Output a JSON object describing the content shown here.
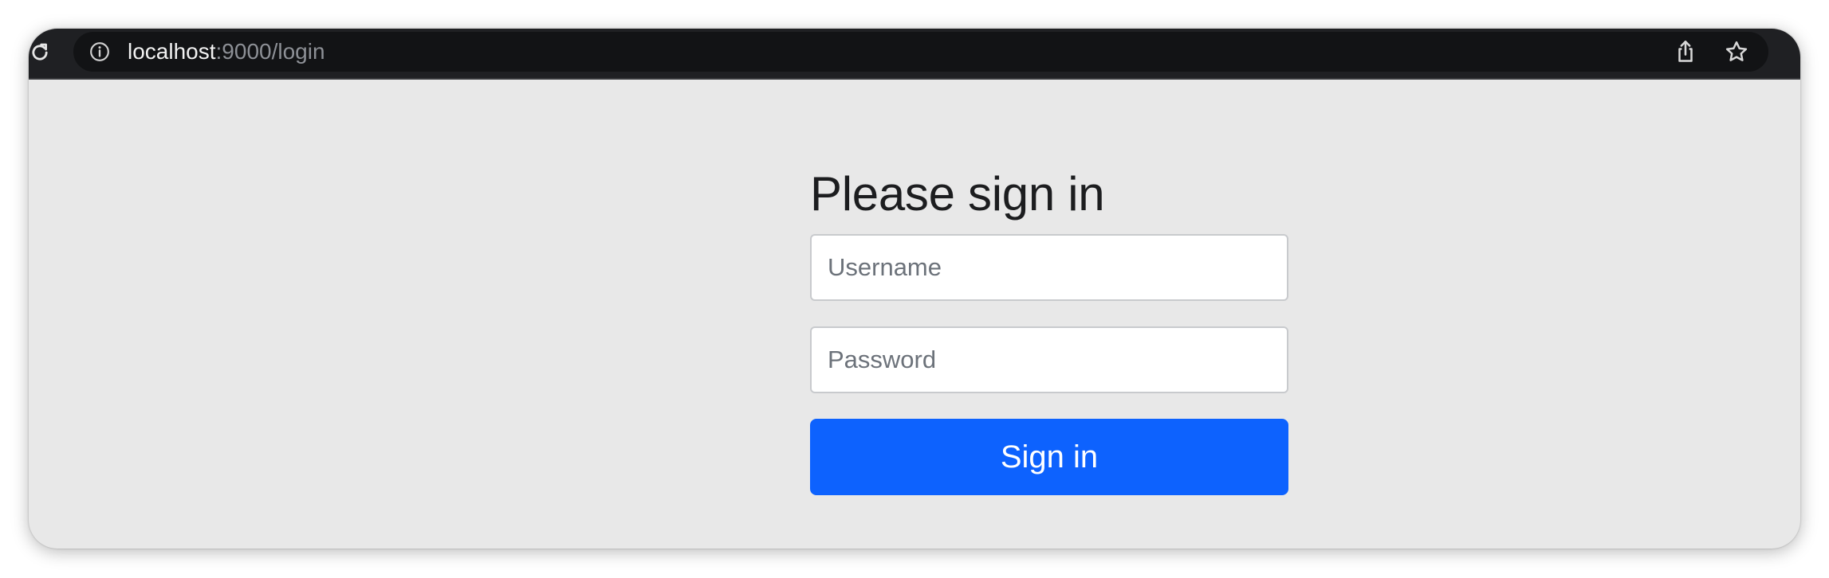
{
  "browser": {
    "url_host": "localhost",
    "url_rest": ":9000/login",
    "icons": {
      "reload": "reload-icon",
      "info": "info-icon",
      "share": "share-icon",
      "bookmark": "star-icon"
    }
  },
  "login": {
    "heading": "Please sign in",
    "username_placeholder": "Username",
    "username_value": "",
    "password_placeholder": "Password",
    "password_value": "",
    "submit_label": "Sign in"
  },
  "colors": {
    "page_background": "#e8e8e8",
    "toolbar": "#1f2023",
    "primary_button": "#0d62fe"
  }
}
